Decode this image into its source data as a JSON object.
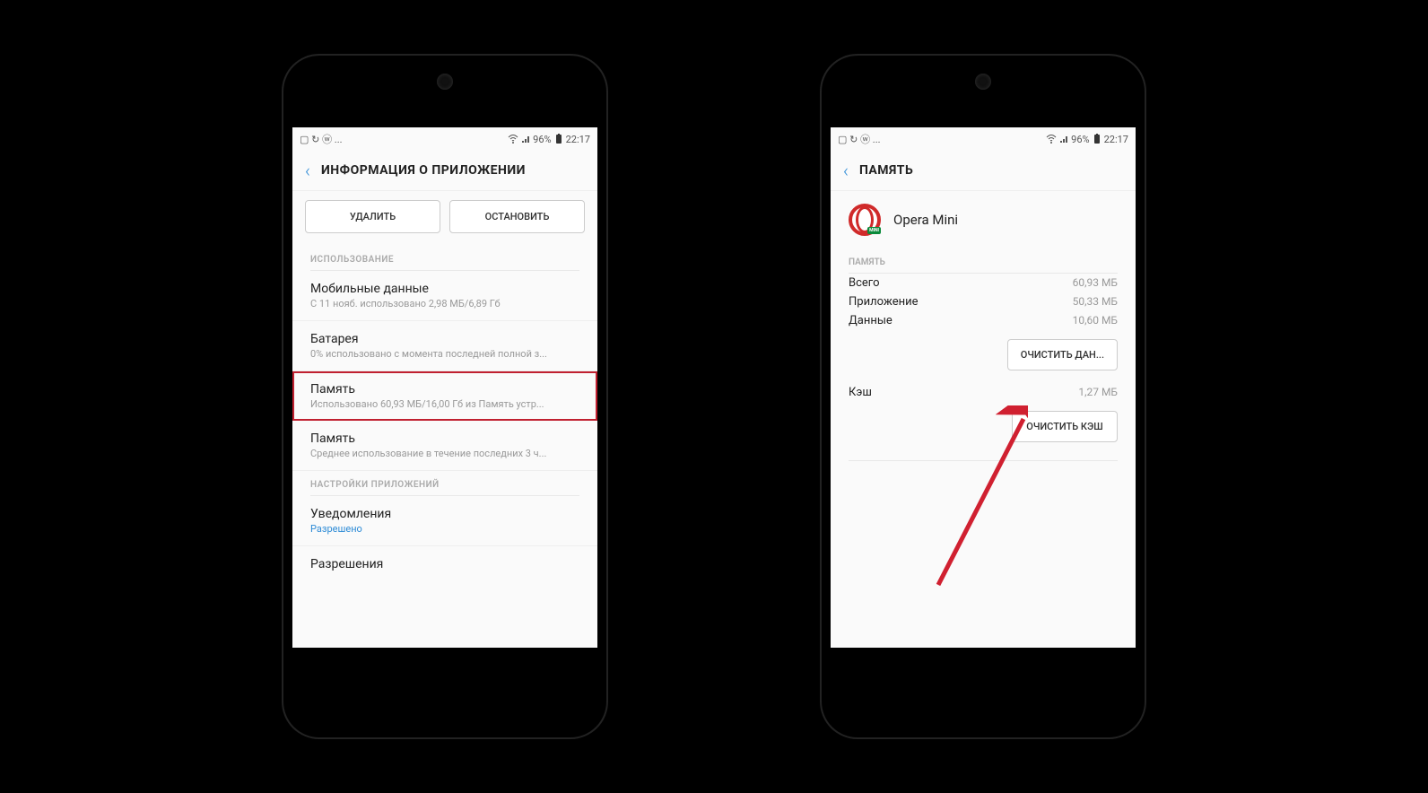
{
  "status": {
    "left_icons": "▢ ↻ ⓦ ...",
    "wifi": "📶",
    "signal": "📶",
    "battery_pct": "96%",
    "time": "22:17"
  },
  "phone1": {
    "header_title": "ИНФОРМАЦИЯ О ПРИЛОЖЕНИИ",
    "buttons": {
      "delete": "УДАЛИТЬ",
      "stop": "ОСТАНОВИТЬ"
    },
    "sections": {
      "usage_label": "ИСПОЛЬЗОВАНИЕ",
      "app_settings_label": "НАСТРОЙКИ ПРИЛОЖЕНИЙ"
    },
    "items": {
      "mobile_data": {
        "title": "Мобильные данные",
        "sub": "С 11 нояб. использовано 2,98 МБ/6,89 Гб"
      },
      "battery": {
        "title": "Батарея",
        "sub": "0% использовано с момента последней полной з..."
      },
      "storage": {
        "title": "Память",
        "sub": "Использовано 60,93 МБ/16,00 Гб из Память устр..."
      },
      "memory": {
        "title": "Память",
        "sub": "Среднее использование в течение последних 3 ч..."
      },
      "notifications": {
        "title": "Уведомления",
        "sub": "Разрешено"
      },
      "permissions": {
        "title": "Разрешения"
      }
    }
  },
  "phone2": {
    "header_title": "ПАМЯТЬ",
    "app_name": "Opera Mini",
    "mem_label": "ПАМЯТЬ",
    "rows": {
      "total": {
        "label": "Всего",
        "value": "60,93 МБ"
      },
      "app": {
        "label": "Приложение",
        "value": "50,33 МБ"
      },
      "data": {
        "label": "Данные",
        "value": "10,60 МБ"
      },
      "cache": {
        "label": "Кэш",
        "value": "1,27 МБ"
      }
    },
    "buttons": {
      "clear_data": "ОЧИСТИТЬ ДАН...",
      "clear_cache": "ОЧИСТИТЬ КЭШ"
    }
  }
}
